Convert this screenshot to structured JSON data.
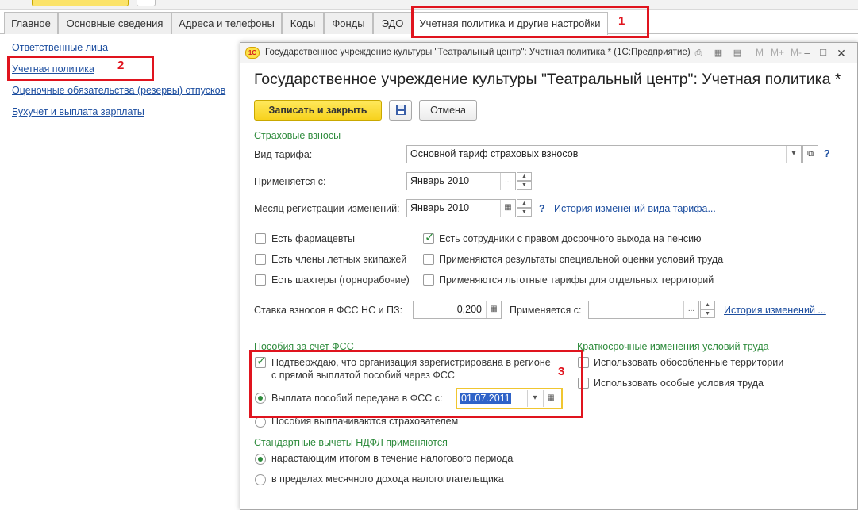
{
  "tabs": [
    {
      "label": "Главное"
    },
    {
      "label": "Основные сведения"
    },
    {
      "label": "Адреса и телефоны"
    },
    {
      "label": "Коды"
    },
    {
      "label": "Фонды"
    },
    {
      "label": "ЭДО"
    },
    {
      "label": "Учетная политика и другие настройки"
    }
  ],
  "sidebar": {
    "items": [
      {
        "label": "Ответственные лица"
      },
      {
        "label": "Учетная политика"
      },
      {
        "label": "Оценочные обязательства (резервы) отпусков"
      },
      {
        "label": "Бухучет и выплата зарплаты"
      }
    ]
  },
  "annotations": [
    "1",
    "2",
    "3"
  ],
  "dialog": {
    "window_title": "Государственное учреждение культуры \"Театральный центр\": Учетная политика * (1С:Предприятие)",
    "logo_text": "1С",
    "toolbar_m": [
      "M",
      "M+",
      "M-"
    ],
    "form_title": "Государственное учреждение культуры \"Театральный центр\": Учетная политика *",
    "buttons": {
      "save_close": "Записать и закрыть",
      "cancel": "Отмена"
    },
    "insurance": {
      "section": "Страховые взносы",
      "tariff_label": "Вид тарифа:",
      "tariff_value": "Основной тариф страховых взносов",
      "applies_label": "Применяется с:",
      "applies_value": "Январь 2010",
      "reg_month_label": "Месяц регистрации изменений:",
      "reg_month_value": "Январь 2010",
      "history_tariff_link": "История изменений вида тарифа...",
      "checkboxes": [
        {
          "label": "Есть фармацевты",
          "checked": false
        },
        {
          "label": "Есть члены летных экипажей",
          "checked": false
        },
        {
          "label": "Есть шахтеры (горнорабочие)",
          "checked": false
        },
        {
          "label": "Есть сотрудники с правом досрочного выхода на пенсию",
          "checked": true
        },
        {
          "label": "Применяются результаты специальной оценки условий труда",
          "checked": false
        },
        {
          "label": "Применяются льготные тарифы для отдельных территорий",
          "checked": false
        }
      ],
      "fss_rate_label": "Ставка взносов в ФСС НС и ПЗ:",
      "fss_rate_value": "0,200",
      "fss_applies_label": "Применяется с:",
      "fss_applies_value": "",
      "history_link": "История изменений ..."
    },
    "benefits": {
      "section": "Пособия за счет ФСС",
      "confirm_line1": "Подтверждаю, что организация зарегистрирована в регионе",
      "confirm_line2": "с прямой выплатой пособий через ФСС",
      "radio_transferred": "Выплата пособий передана в ФСС с:",
      "transfer_date": "01.07.2011",
      "radio_employer": "Пособия выплачиваются страхователем"
    },
    "short_term": {
      "section": "Краткосрочные изменения условий труда",
      "options": [
        {
          "label": "Использовать обособленные территории"
        },
        {
          "label": "Использовать особые условия труда"
        }
      ]
    },
    "ndfl": {
      "section": "Стандартные вычеты НДФЛ применяются",
      "options": [
        {
          "label": "нарастающим итогом в течение налогового периода",
          "selected": true
        },
        {
          "label": "в пределах месячного дохода налогоплательщика",
          "selected": false
        }
      ]
    }
  }
}
